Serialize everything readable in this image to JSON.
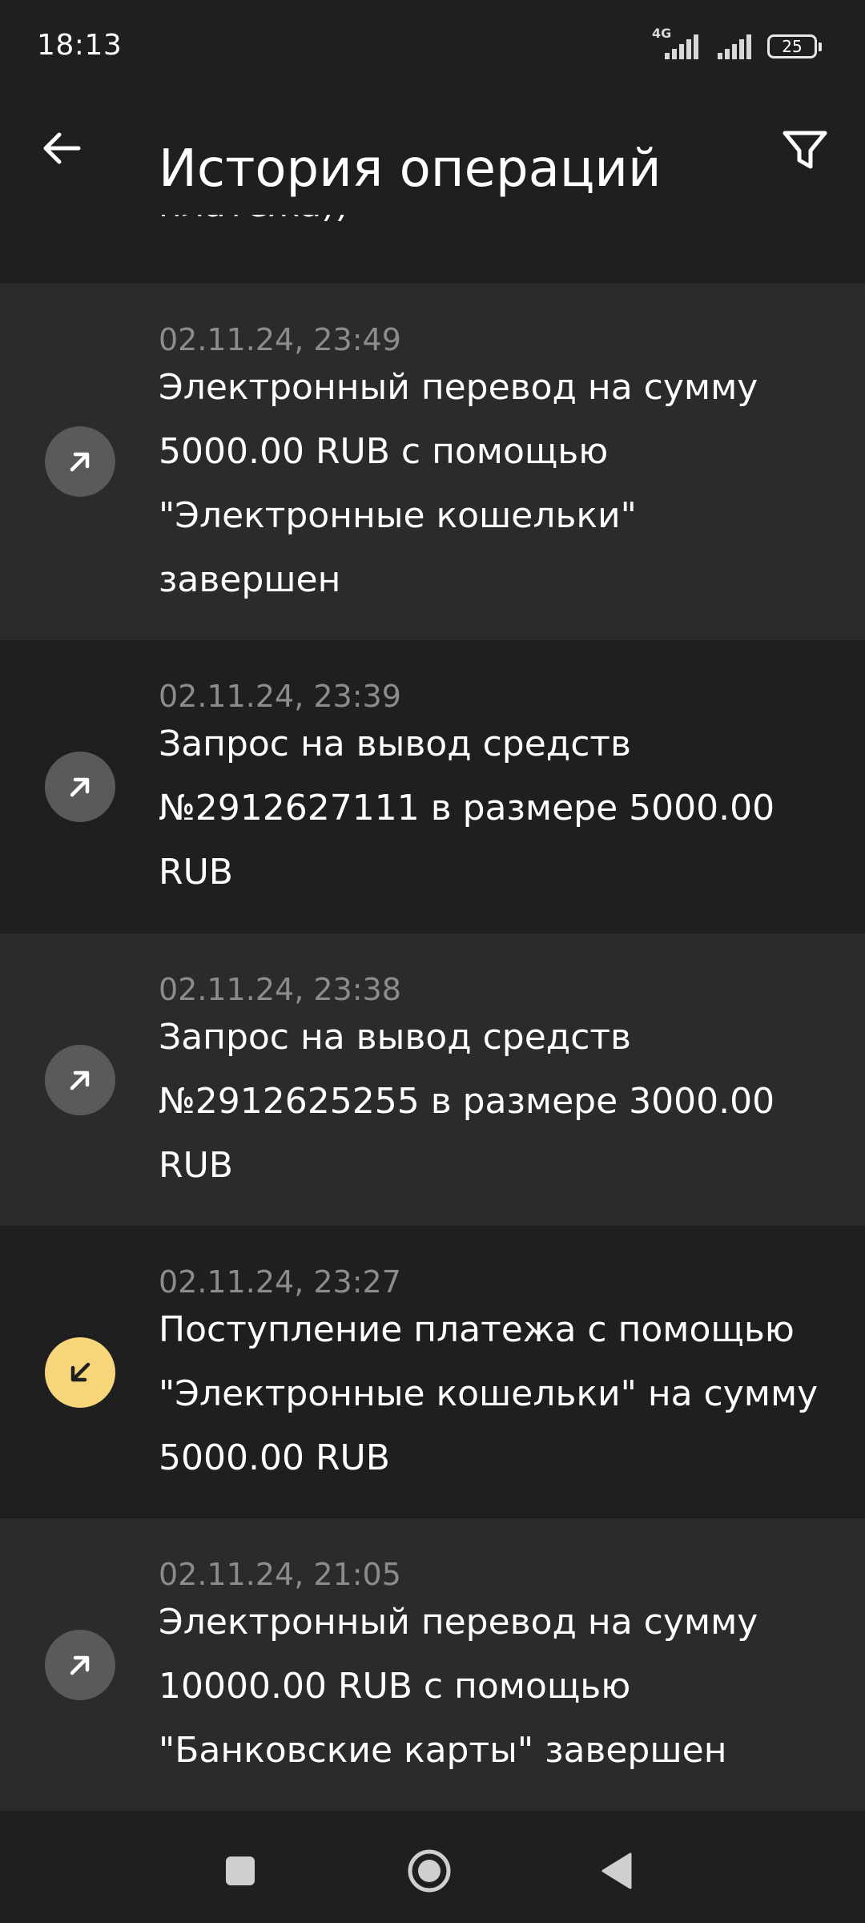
{
  "status_bar": {
    "time": "18:13",
    "network": "4G",
    "battery": "25"
  },
  "header": {
    "title": "История операций",
    "back_icon": "arrow-left-icon",
    "filter_icon": "filter-icon"
  },
  "clipped_text": "платежа))",
  "operations": [
    {
      "date": "02.11.24, 23:49",
      "text": "Электронный перевод на сумму 5000.00 RUB с помощью \"Электронные кошельки\" завершен",
      "direction": "outgoing",
      "icon": "arrow-up-right-icon"
    },
    {
      "date": "02.11.24, 23:39",
      "text": "Запрос на вывод средств №2912627111 в размере 5000.00 RUB",
      "direction": "outgoing",
      "icon": "arrow-up-right-icon"
    },
    {
      "date": "02.11.24, 23:38",
      "text": "Запрос на вывод средств №2912625255 в размере 3000.00 RUB",
      "direction": "outgoing",
      "icon": "arrow-up-right-icon"
    },
    {
      "date": "02.11.24, 23:27",
      "text": "Поступление платежа с помощью \"Электронные кошельки\" на сумму 5000.00 RUB",
      "direction": "incoming",
      "icon": "arrow-down-left-icon"
    },
    {
      "date": "02.11.24, 21:05",
      "text": "Электронный перевод на сумму 10000.00 RUB с помощью \"Банковские карты\" завершен",
      "direction": "outgoing",
      "icon": "arrow-up-right-icon"
    }
  ],
  "colors": {
    "background": "#1f1f1f",
    "row_alt": "#2b2b2b",
    "outgoing_icon_bg": "#5a5a5a",
    "incoming_icon_bg": "#f7d57a",
    "date_text": "#8c8c8c"
  },
  "nav": {
    "recents_icon": "square-icon",
    "home_icon": "circle-icon",
    "back_icon": "triangle-back-icon"
  }
}
